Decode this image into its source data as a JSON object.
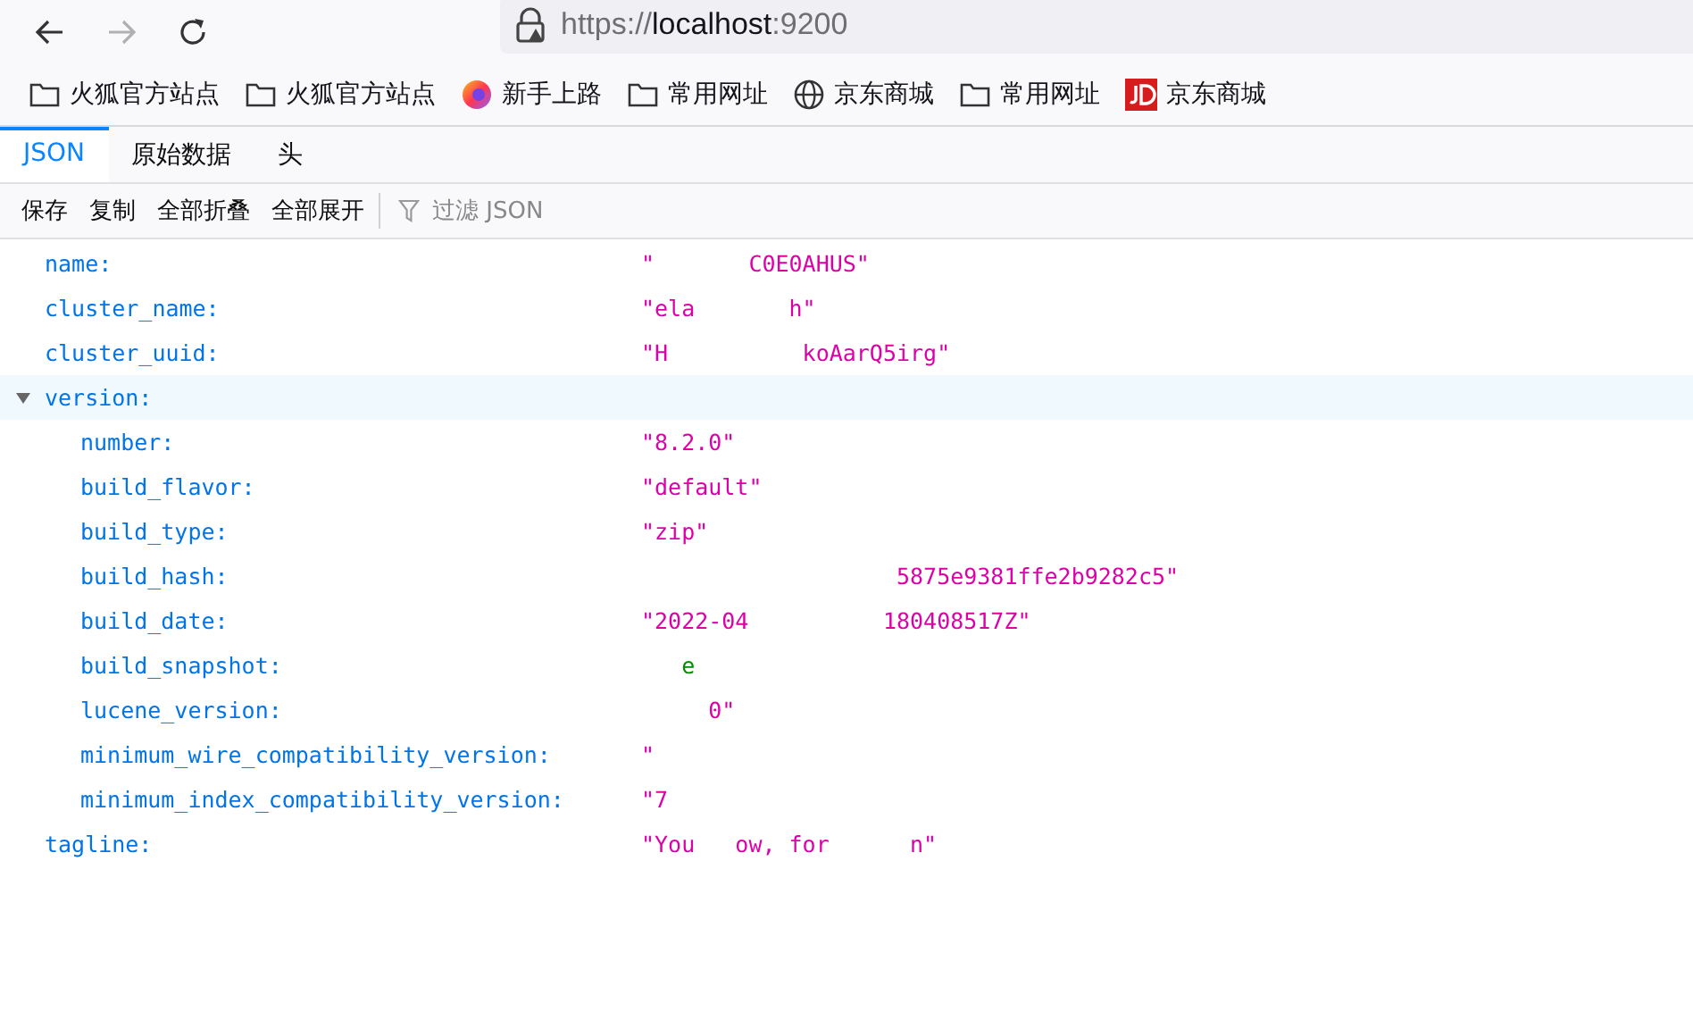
{
  "nav": {
    "back_disabled": false,
    "forward_disabled": true,
    "url_prefix": "https://",
    "url_host": "localhost",
    "url_port": ":9200"
  },
  "bookmarks": [
    {
      "kind": "folder",
      "label": "火狐官方站点"
    },
    {
      "kind": "folder",
      "label": "火狐官方站点"
    },
    {
      "kind": "firefox",
      "label": "新手上路"
    },
    {
      "kind": "folder",
      "label": "常用网址"
    },
    {
      "kind": "globe",
      "label": "京东商城"
    },
    {
      "kind": "folder",
      "label": "常用网址"
    },
    {
      "kind": "jd",
      "label": "京东商城"
    }
  ],
  "tabs": [
    {
      "label": "JSON",
      "selected": true
    },
    {
      "label": "原始数据",
      "selected": false
    },
    {
      "label": "头",
      "selected": false
    }
  ],
  "toolbar": {
    "buttons": [
      "保存",
      "复制",
      "全部折叠",
      "全部展开"
    ],
    "filter": {
      "placeholder": "过滤 JSON"
    }
  },
  "rows": [
    {
      "key": "name:",
      "value": "\"       C0E0AHUS\"",
      "kind": "string",
      "highlighted": false
    },
    {
      "key": "cluster_name:",
      "value": "\"ela       h\"",
      "kind": "string",
      "highlighted": false
    },
    {
      "key": "cluster_uuid:",
      "value": "\"H          koAarQ5irg\"",
      "kind": "string",
      "highlighted": false
    },
    {
      "key": "version:",
      "kind": "object",
      "expanded": true,
      "highlighted": true,
      "children": [
        {
          "key": "number:",
          "value": "\"8.2.0\"",
          "kind": "string",
          "highlighted": false
        },
        {
          "key": "build_flavor:",
          "value": "\"default\"",
          "kind": "string",
          "highlighted": false
        },
        {
          "key": "build_type:",
          "value": "\"zip\"",
          "kind": "string",
          "highlighted": false
        },
        {
          "key": "build_hash:",
          "value": "                   5875e9381ffe2b9282c5\"",
          "kind": "string",
          "highlighted": false
        },
        {
          "key": "build_date:",
          "value": "\"2022-04          180408517Z\"",
          "kind": "string",
          "highlighted": false
        },
        {
          "key": "build_snapshot:",
          "value": "   e",
          "kind": "boolean",
          "highlighted": false
        },
        {
          "key": "lucene_version:",
          "value": "     0\"",
          "kind": "string",
          "highlighted": false
        },
        {
          "key": "minimum_wire_compatibility_version:",
          "value": "\"",
          "kind": "string",
          "highlighted": false
        },
        {
          "key": "minimum_index_compatibility_version:",
          "value": "\"7",
          "kind": "string",
          "highlighted": false
        }
      ]
    },
    {
      "key": "tagline:",
      "value": "\"You   ow, for      n\"",
      "kind": "string",
      "highlighted": false
    }
  ]
}
